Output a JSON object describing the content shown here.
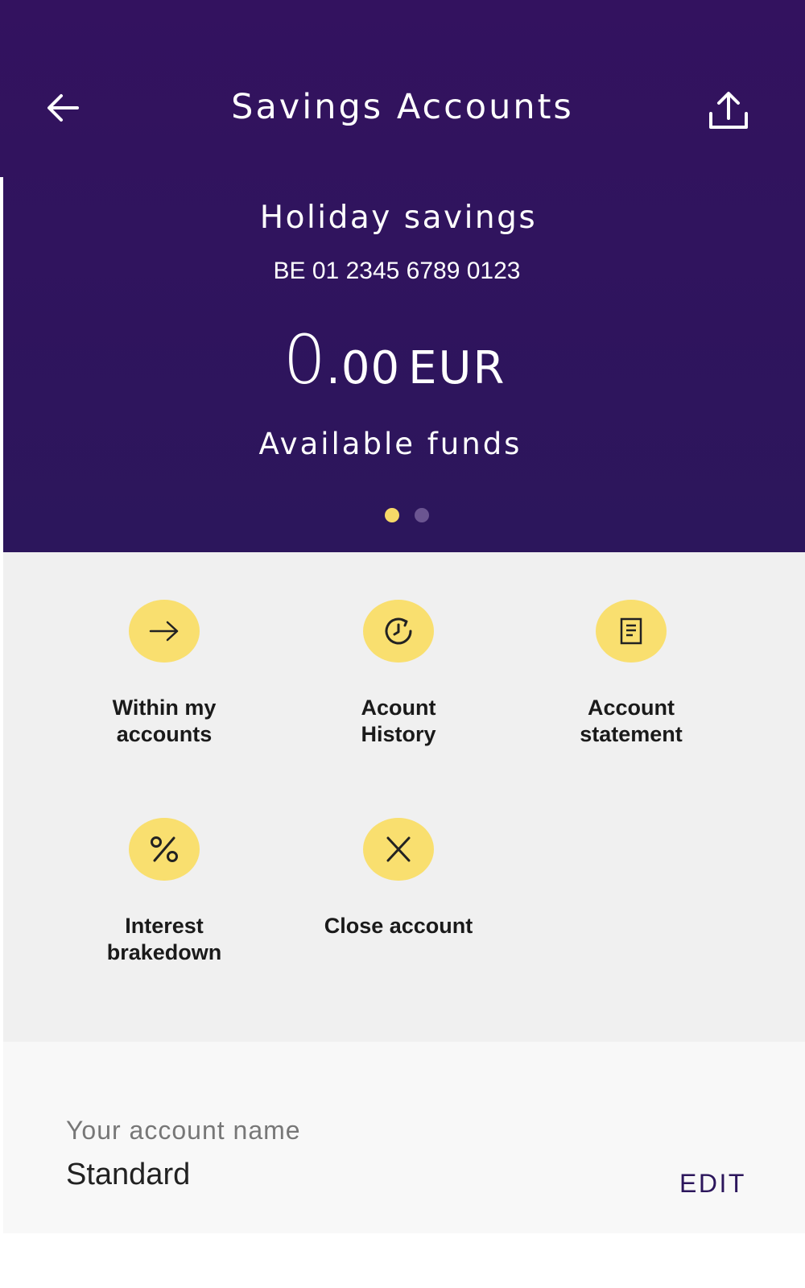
{
  "header": {
    "title": "Savings Accounts",
    "back_icon": "arrow-left-icon",
    "share_icon": "share-upload-icon",
    "background_color": "#2c165c"
  },
  "account": {
    "label": "Holiday savings",
    "iban": "BE 01 2345 6789 0123",
    "balance_integer": "0",
    "balance_decimal": ".00",
    "currency": "EUR",
    "balance_caption": "Available funds"
  },
  "carousel": {
    "page_count": 2,
    "active_index": 0,
    "active_color": "#f7d968"
  },
  "actions": [
    {
      "label_line1": "Within my",
      "label_line2": "accounts",
      "icon": "arrow-right-icon"
    },
    {
      "label_line1": "Acount",
      "label_line2": "History",
      "icon": "history-clock-icon"
    },
    {
      "label_line1": "Account",
      "label_line2": "statement",
      "icon": "document-icon"
    },
    {
      "label_line1": "Interest",
      "label_line2": "brakedown",
      "icon": "percent-icon"
    },
    {
      "label_line1": "Close account",
      "label_line2": "",
      "icon": "close-x-icon"
    }
  ],
  "action_circle_color": "#f9df6f",
  "name_card": {
    "caption": "Your account name",
    "value": "Standard",
    "edit_label": "EDIT"
  }
}
